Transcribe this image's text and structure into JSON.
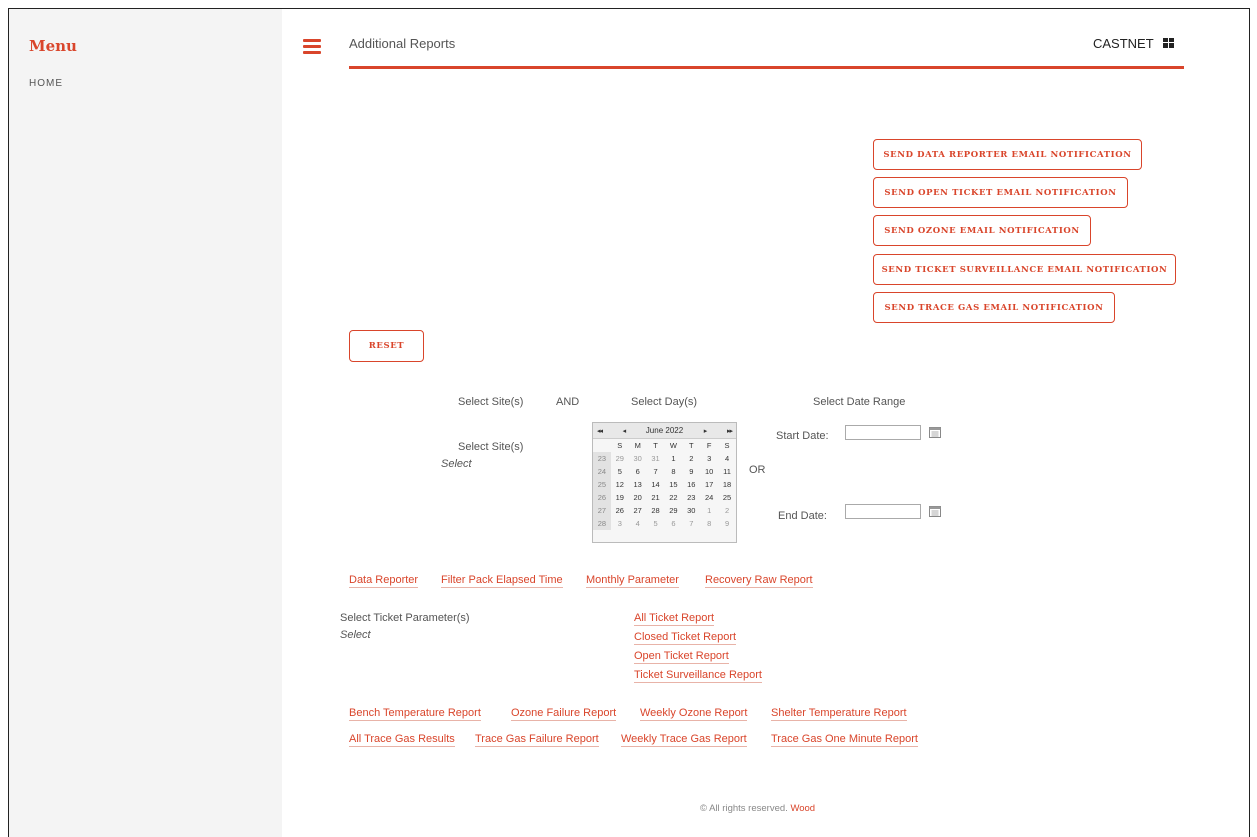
{
  "sidebar": {
    "title": "Menu",
    "home": "HOME"
  },
  "header": {
    "title": "Additional Reports",
    "brand": "CASTNET"
  },
  "notify_buttons": [
    "SEND DATA REPORTER EMAIL NOTIFICATION",
    "SEND OPEN TICKET EMAIL NOTIFICATION",
    "SEND OZONE EMAIL NOTIFICATION",
    "SEND TICKET SURVEILLANCE EMAIL NOTIFICATION",
    "SEND TRACE GAS EMAIL NOTIFICATION"
  ],
  "reset": "RESET",
  "selectors": {
    "sites_heading": "Select Site(s)",
    "and": "AND",
    "days_heading": "Select Day(s)",
    "range_heading": "Select Date Range",
    "sites_label": "Select Site(s)",
    "sites_value": "Select",
    "or": "OR",
    "start_label": "Start Date:",
    "end_label": "End Date:",
    "start_value": "",
    "end_value": ""
  },
  "calendar": {
    "prev_year": "◂◂",
    "prev_month": "◂",
    "month": "June 2022",
    "next_month": "▸",
    "next_year": "▸▸",
    "dow": [
      "S",
      "M",
      "T",
      "W",
      "T",
      "F",
      "S"
    ],
    "weeks": [
      {
        "wk": "23",
        "days": [
          "29",
          "30",
          "31",
          "1",
          "2",
          "3",
          "4"
        ]
      },
      {
        "wk": "24",
        "days": [
          "5",
          "6",
          "7",
          "8",
          "9",
          "10",
          "11"
        ]
      },
      {
        "wk": "25",
        "days": [
          "12",
          "13",
          "14",
          "15",
          "16",
          "17",
          "18"
        ]
      },
      {
        "wk": "26",
        "days": [
          "19",
          "20",
          "21",
          "22",
          "23",
          "24",
          "25"
        ]
      },
      {
        "wk": "27",
        "days": [
          "26",
          "27",
          "28",
          "29",
          "30",
          "1",
          "2"
        ]
      },
      {
        "wk": "28",
        "days": [
          "3",
          "4",
          "5",
          "6",
          "7",
          "8",
          "9"
        ]
      }
    ]
  },
  "report_links_1": [
    "Data Reporter",
    "Filter Pack Elapsed Time",
    "Monthly Parameter",
    "Recovery Raw Report"
  ],
  "ticket": {
    "label": "Select Ticket Parameter(s)",
    "value": "Select",
    "links": [
      "All Ticket Report",
      "Closed Ticket Report",
      "Open Ticket Report",
      "Ticket Surveillance Report"
    ]
  },
  "report_links_2": [
    "Bench Temperature Report",
    "Ozone Failure Report",
    "Weekly Ozone Report",
    "Shelter Temperature Report"
  ],
  "report_links_3": [
    "All Trace Gas Results",
    "Trace Gas Failure Report",
    "Weekly Trace Gas Report",
    "Trace Gas One Minute Report"
  ],
  "footer": {
    "text": "© All rights reserved.",
    "company": "Wood"
  },
  "colors": {
    "accent": "#d9452b",
    "sidebar_bg": "#f4f4f4"
  }
}
